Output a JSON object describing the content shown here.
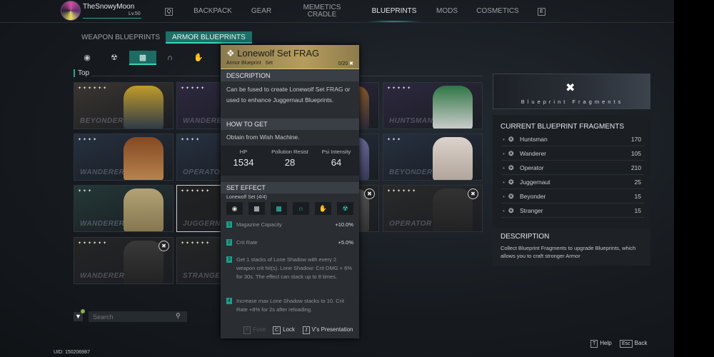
{
  "player": {
    "name": "TheSnowyMoon",
    "level": "Lv.50",
    "uid": "UID: 150206987"
  },
  "nav": {
    "prev_key": "Q",
    "next_key": "E",
    "items": [
      {
        "label": "BACKPACK",
        "active": false
      },
      {
        "label": "GEAR",
        "active": false
      },
      {
        "label": "MEMETICS CRADLE",
        "active": false
      },
      {
        "label": "BLUEPRINTS",
        "active": true
      },
      {
        "label": "MODS",
        "active": false
      },
      {
        "label": "COSMETICS",
        "active": false
      }
    ]
  },
  "subtabs": [
    {
      "label": "WEAPON BLUEPRINTS",
      "active": false
    },
    {
      "label": "ARMOR BLUEPRINTS",
      "active": true
    }
  ],
  "categories": [
    {
      "icon": "helmet-icon"
    },
    {
      "icon": "mask-icon"
    },
    {
      "icon": "top-icon",
      "active": true
    },
    {
      "icon": "pants-icon"
    },
    {
      "icon": "gloves-icon"
    }
  ],
  "section_label": "Top",
  "grid": [
    {
      "class": "BEYONDER",
      "stars": 6,
      "colors": [
        "#c9a12a",
        "#2a3a4a"
      ],
      "bg": "#3a3530"
    },
    {
      "class": "WANDERER",
      "stars": 5,
      "colors": [
        "#5a2a2a",
        "#3a2a4a"
      ],
      "bg": "#2e2840"
    },
    {
      "class": "",
      "stars": 5,
      "colors": [
        "#8a5a2a",
        "#2a2a3a"
      ],
      "bg": "#2e2840"
    },
    {
      "class": "HUNTSMAN",
      "stars": 5,
      "colors": [
        "#2f7a45",
        "#d8d8d8"
      ],
      "bg": "#2e2840"
    },
    {
      "class": "WANDERER",
      "stars": 4,
      "colors": [
        "#8a4a22",
        "#c08a50"
      ],
      "bg": "#263040"
    },
    {
      "class": "OPERATOR",
      "stars": 4,
      "colors": [
        "#9a7a3a",
        "#3a3a3a"
      ],
      "bg": "#263040"
    },
    {
      "class": "",
      "stars": 4,
      "colors": [
        "#6a6a9a",
        "#3a3a5a"
      ],
      "bg": "#263040"
    },
    {
      "class": "BEYONDER",
      "stars": 3,
      "colors": [
        "#e5dcd4",
        "#b8aaa0"
      ],
      "bg": "#263040"
    },
    {
      "class": "WANDERER",
      "stars": 3,
      "colors": [
        "#bba878",
        "#8a7a52"
      ],
      "bg": "#243838"
    },
    {
      "class": "JUGGERNAUT",
      "stars": 6,
      "colors": [
        "#222",
        "#2a2a2a"
      ],
      "bg": "#222",
      "selected": true
    },
    {
      "class": "",
      "stars": 6,
      "colors": [
        "#555",
        "#333"
      ],
      "bg": "#2a2a2a",
      "locked": true
    },
    {
      "class": "OPERATOR",
      "stars": 6,
      "colors": [
        "#333",
        "#222"
      ],
      "bg": "#2a2a2a",
      "locked": true
    },
    {
      "class": "WANDERER",
      "stars": 6,
      "colors": [
        "#3a3a3a",
        "#222"
      ],
      "bg": "#252525",
      "locked": true
    },
    {
      "class": "STRANGER",
      "stars": 6,
      "colors": [
        "#444",
        "#2a2a2a"
      ],
      "bg": "#252525"
    }
  ],
  "tooltip": {
    "title": "Lonewolf Set FRAG",
    "type": "Armor Blueprint",
    "tag": "Set",
    "count": "0/20",
    "description_header": "DESCRIPTION",
    "description": "Can be fused to create Lonewolf Set FRAG or used to enhance Juggernaut Blueprints.",
    "how_header": "HOW TO GET",
    "how": "Obtain from Wish Machine.",
    "stats": [
      {
        "label": "HP",
        "value": "1534"
      },
      {
        "label": "Pollution Resist",
        "value": "28"
      },
      {
        "label": "Psi Intensity",
        "value": "64"
      }
    ],
    "set_header": "SET EFFECT",
    "set_name": "Lonewolf Set (4/4)",
    "set_pieces": [
      {
        "icon": "helmet-icon",
        "owned": false
      },
      {
        "icon": "top-icon",
        "owned": false
      },
      {
        "icon": "top-icon",
        "owned": true
      },
      {
        "icon": "pants-icon",
        "owned": true
      },
      {
        "icon": "gloves-icon",
        "owned": true
      },
      {
        "icon": "mask-icon",
        "owned": true
      }
    ],
    "effects": [
      {
        "n": "1",
        "text": "Magazine Capacity",
        "value": "+10.0%"
      },
      {
        "n": "2",
        "text": "Crit Rate",
        "value": "+5.0%"
      },
      {
        "n": "3",
        "text": "Get 1 stacks of Lone Shadow with every 2 weapon crit hit(s). Lone Shadow: Crit DMG + 6% for 30s. The effect can stack up to 8 times."
      },
      {
        "n": "4",
        "text": "Increase max Lone Shadow stacks to 10. Crit Rate +8% for 2s after reloading."
      }
    ],
    "actions": [
      {
        "key": "F",
        "label": "Fuse",
        "disabled": true
      },
      {
        "key": "C",
        "label": "Lock"
      },
      {
        "key": "J",
        "label": "V's Presentation"
      }
    ]
  },
  "banner": {
    "label": "Blueprint Fragments"
  },
  "fragments": {
    "header": "CURRENT BLUEPRINT FRAGMENTS",
    "items": [
      {
        "name": "Huntsman",
        "count": "170"
      },
      {
        "name": "Wanderer",
        "count": "105"
      },
      {
        "name": "Operator",
        "count": "210"
      },
      {
        "name": "Juggernaut",
        "count": "25"
      },
      {
        "name": "Beyonder",
        "count": "15"
      },
      {
        "name": "Stranger",
        "count": "15"
      }
    ]
  },
  "description": {
    "header": "DESCRIPTION",
    "text": "Collect Blueprint Fragments to upgrade Blueprints, which allows you to craft stronger Armor"
  },
  "search": {
    "placeholder": "Search"
  },
  "hints": [
    {
      "key": "T",
      "label": "Help"
    },
    {
      "key": "Esc",
      "label": "Back"
    }
  ],
  "colors": {
    "accent": "#1e6f66",
    "accent_bright": "#3ad6c0",
    "gold": "#b59d5e"
  }
}
